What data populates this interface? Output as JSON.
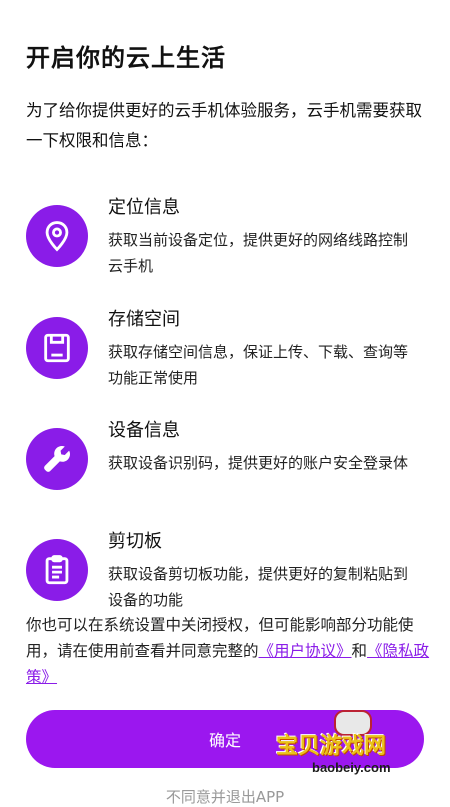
{
  "title": "开启你的云上生活",
  "intro": "为了给你提供更好的云手机体验服务，云手机需要获取一下权限和信息：",
  "permissions": [
    {
      "icon": "location-icon",
      "title": "定位信息",
      "desc": "获取当前设备定位，提供更好的网络线路控制云手机"
    },
    {
      "icon": "storage-icon",
      "title": "存储空间",
      "desc": "获取存储空间信息，保证上传、下载、查询等功能正常使用"
    },
    {
      "icon": "wrench-icon",
      "title": "设备信息",
      "desc": "获取设备识别码，提供更好的账户安全登录体"
    },
    {
      "icon": "clipboard-icon",
      "title": "剪切板",
      "desc": "获取设备剪切板功能，提供更好的复制粘贴到设备的功能"
    }
  ],
  "footer": {
    "text_before": "你也可以在系统设置中关闭授权，但可能影响部分功能使用，请在使用前查看并同意完整的",
    "link_user_agreement": "《用户协议》",
    "connector": "和",
    "link_privacy_policy": "《隐私政策》"
  },
  "buttons": {
    "confirm": "确定",
    "decline": "不同意并退出APP"
  },
  "watermark": {
    "title": "宝贝游戏网",
    "url": "baobeiy.com"
  },
  "colors": {
    "accent": "#8a1ce8",
    "button": "#9b17ef"
  }
}
